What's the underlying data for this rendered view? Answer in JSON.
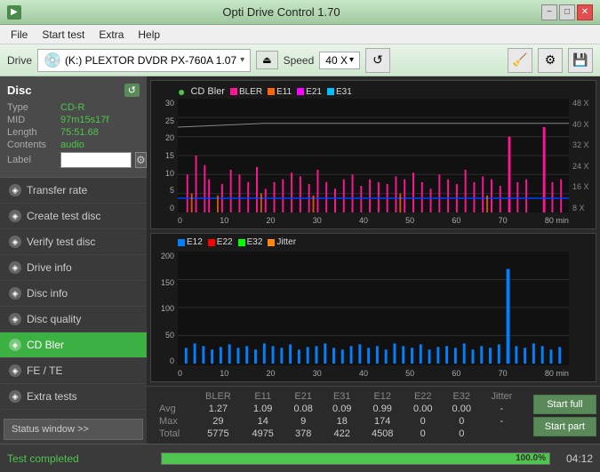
{
  "titlebar": {
    "title": "Opti Drive Control 1.70",
    "icon": "⬜",
    "minimize": "−",
    "maximize": "□",
    "close": "✕"
  },
  "menubar": {
    "items": [
      "File",
      "Start test",
      "Extra",
      "Help"
    ]
  },
  "toolbar": {
    "drive_label": "Drive",
    "drive_icon": "💿",
    "drive_text": "(K:)  PLEXTOR DVDR  PX-760A 1.07",
    "eject_icon": "⏏",
    "speed_label": "Speed",
    "speed_value": "40 X",
    "arrow_icon": "▾",
    "refresh_icon": "↺"
  },
  "disc_panel": {
    "title": "Disc",
    "refresh_label": "↺",
    "type_label": "Type",
    "type_value": "CD-R",
    "mid_label": "MID",
    "mid_value": "97m15s17f",
    "length_label": "Length",
    "length_value": "75:51.68",
    "contents_label": "Contents",
    "contents_value": "audio",
    "label_label": "Label",
    "label_placeholder": ""
  },
  "sidebar": {
    "items": [
      {
        "id": "transfer-rate",
        "label": "Transfer rate",
        "active": false
      },
      {
        "id": "create-test-disc",
        "label": "Create test disc",
        "active": false
      },
      {
        "id": "verify-test-disc",
        "label": "Verify test disc",
        "active": false
      },
      {
        "id": "drive-info",
        "label": "Drive info",
        "active": false
      },
      {
        "id": "disc-info",
        "label": "Disc info",
        "active": false
      },
      {
        "id": "disc-quality",
        "label": "Disc quality",
        "active": false
      },
      {
        "id": "cd-bler",
        "label": "CD Bler",
        "active": true
      },
      {
        "id": "fe-te",
        "label": "FE / TE",
        "active": false
      },
      {
        "id": "extra-tests",
        "label": "Extra tests",
        "active": false
      }
    ],
    "status_window": "Status window >>"
  },
  "chart1": {
    "title": "CD Bler",
    "legend": [
      {
        "label": "BLER",
        "color": "#ff1493"
      },
      {
        "label": "E11",
        "color": "#ff6600"
      },
      {
        "label": "E21",
        "color": "#ff00ff"
      },
      {
        "label": "E31",
        "color": "#00bfff"
      }
    ],
    "y_labels": [
      "30",
      "25",
      "20",
      "15",
      "10",
      "5",
      "0"
    ],
    "y_right": [
      "48 X",
      "40 X",
      "32 X",
      "24 X",
      "16 X",
      "8 X"
    ],
    "x_labels": [
      "0",
      "10",
      "20",
      "30",
      "40",
      "50",
      "60",
      "70",
      "80 min"
    ]
  },
  "chart2": {
    "legend": [
      {
        "label": "E12",
        "color": "#0080ff"
      },
      {
        "label": "E22",
        "color": "#ff0000"
      },
      {
        "label": "E32",
        "color": "#00ff00"
      },
      {
        "label": "Jitter",
        "color": "#ff8800"
      }
    ],
    "y_labels": [
      "200",
      "150",
      "100",
      "50",
      "0"
    ],
    "x_labels": [
      "0",
      "10",
      "20",
      "30",
      "40",
      "50",
      "60",
      "70",
      "80 min"
    ]
  },
  "stats": {
    "headers": [
      "",
      "BLER",
      "E11",
      "E21",
      "E31",
      "E12",
      "E22",
      "E32",
      "Jitter"
    ],
    "rows": [
      {
        "label": "Avg",
        "values": [
          "1.27",
          "1.09",
          "0.08",
          "0.09",
          "0.99",
          "0.00",
          "0.00",
          "-"
        ]
      },
      {
        "label": "Max",
        "values": [
          "29",
          "14",
          "9",
          "18",
          "174",
          "0",
          "0",
          "-"
        ]
      },
      {
        "label": "Total",
        "values": [
          "5775",
          "4975",
          "378",
          "422",
          "4508",
          "0",
          "0",
          ""
        ]
      }
    ]
  },
  "buttons": {
    "start_full": "Start full",
    "start_part": "Start part"
  },
  "statusbar": {
    "status_text": "Test completed",
    "progress_percent": 100,
    "progress_label": "100.0%",
    "time": "04:12"
  }
}
